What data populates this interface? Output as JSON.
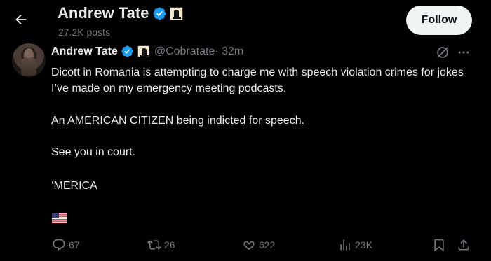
{
  "header": {
    "back_icon": "arrow-left-icon",
    "name": "Andrew Tate",
    "posts": "27.2K posts",
    "follow_label": "Follow"
  },
  "tweet": {
    "name": "Andrew Tate",
    "handle": "@Cobratate",
    "time": " · 32m",
    "paragraphs": [
      "Dicott in Romania is attempting to charge me with speech violation crimes for jokes I’ve made on my emergency meeting podcasts.",
      "An AMERICAN CITIZEN being indicted for speech.",
      "See you in court.",
      "‘MERICA"
    ],
    "flag_emoji": "us-flag"
  },
  "actions": {
    "replies": "67",
    "reposts": "26",
    "likes": "622",
    "views": "23K"
  },
  "colors": {
    "background": "#000000",
    "text": "#e7e9ea",
    "muted": "#71767b",
    "verified": "#1d9bf0",
    "follow_bg": "#eff3f4"
  }
}
